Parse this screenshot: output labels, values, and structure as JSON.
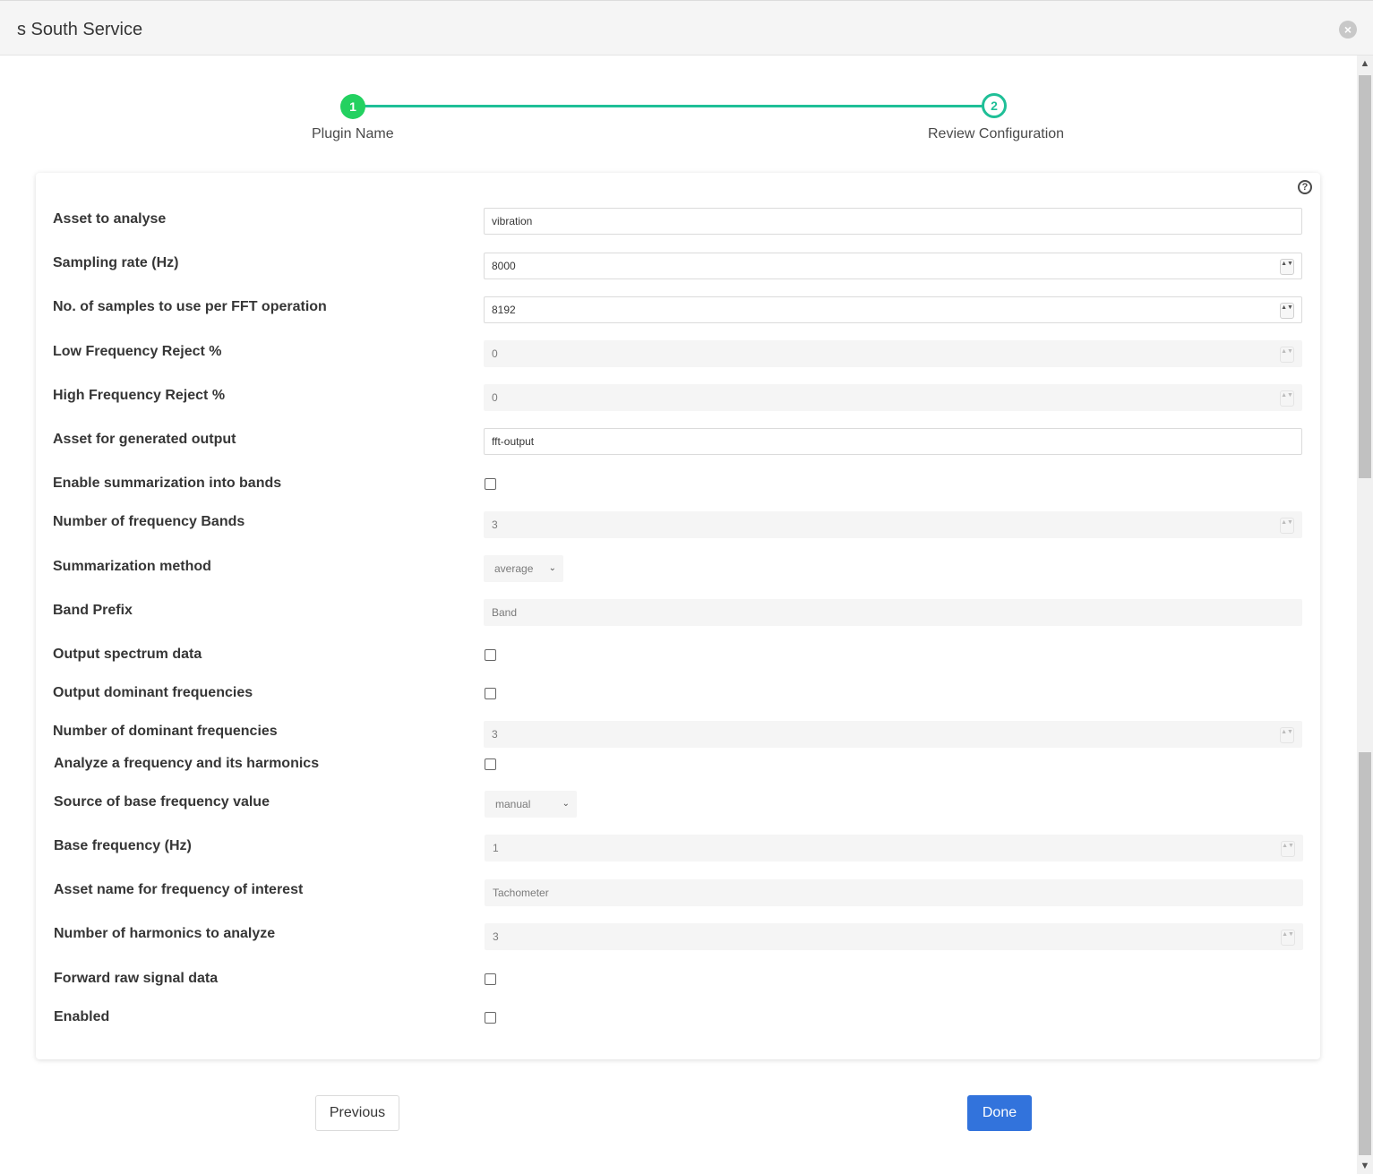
{
  "modal": {
    "title": "s South Service",
    "close_glyph": "×"
  },
  "stepper": {
    "steps": [
      {
        "number": "1",
        "label": "Plugin Name",
        "state": "complete"
      },
      {
        "number": "2",
        "label": "Review Configuration",
        "state": "active"
      }
    ],
    "colors": {
      "complete": "#23d160",
      "active": "#1fbf97"
    }
  },
  "help_glyph": "?",
  "fields": {
    "asset": {
      "label": "Asset to analyse",
      "value": "vibration"
    },
    "sampling_rate": {
      "label": "Sampling rate (Hz)",
      "value": "8000"
    },
    "samples_fft": {
      "label": "No. of samples to use per FFT operation",
      "value": "8192"
    },
    "low_reject": {
      "label": "Low Frequency Reject %",
      "value": "0"
    },
    "high_reject": {
      "label": "High Frequency Reject %",
      "value": "0"
    },
    "output_asset": {
      "label": "Asset for generated output",
      "value": "fft-output"
    },
    "enable_bands": {
      "label": "Enable summarization into bands",
      "checked": false
    },
    "num_bands": {
      "label": "Number of frequency Bands",
      "value": "3"
    },
    "summ_method": {
      "label": "Summarization method",
      "value": "average"
    },
    "band_prefix": {
      "label": "Band Prefix",
      "value": "Band"
    },
    "output_spectrum": {
      "label": "Output spectrum data",
      "checked": false
    },
    "output_dominant": {
      "label": "Output dominant frequencies",
      "checked": false
    },
    "num_dominant": {
      "label": "Number of dominant frequencies",
      "value": "3"
    },
    "analyze_harmonics": {
      "label": "Analyze a frequency and its harmonics",
      "checked": false
    },
    "base_source": {
      "label": "Source of base frequency value",
      "value": "manual"
    },
    "base_freq": {
      "label": "Base frequency (Hz)",
      "value": "1"
    },
    "asset_interest": {
      "label": "Asset name for frequency of interest",
      "value": "Tachometer"
    },
    "num_harmonics": {
      "label": "Number of harmonics to analyze",
      "value": "3"
    },
    "forward_raw": {
      "label": "Forward raw signal data",
      "checked": false
    },
    "enabled": {
      "label": "Enabled",
      "checked": false
    }
  },
  "buttons": {
    "previous": "Previous",
    "done": "Done"
  },
  "icons": {
    "spin": "▲▼",
    "chevron": "⌄",
    "scroll_up": "▲",
    "scroll_down": "▼"
  },
  "accent_color": "#3273dc"
}
